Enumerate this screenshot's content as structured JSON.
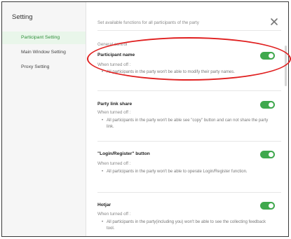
{
  "sidebar": {
    "title": "Setting",
    "items": [
      {
        "label": "Participant Setting",
        "active": true
      },
      {
        "label": "Main Window Setting",
        "active": false
      },
      {
        "label": "Proxy Setting",
        "active": false
      }
    ]
  },
  "main": {
    "subtitle": "Set available functions for all participants of the party",
    "section_label": "General control",
    "settings": [
      {
        "title": "Participant name",
        "when_off": "When turned off :",
        "description": "All participants in the party won't be able to modify their party names.",
        "enabled": true
      },
      {
        "title": "Party link share",
        "when_off": "When turned off :",
        "description": "All participants in the party won't be able see \"copy\" button and can not share the party link.",
        "enabled": true
      },
      {
        "title": "\"Login/Register\" button",
        "when_off": "When turned off :",
        "description": "All participants in the party won't be able to operate Login/Register function.",
        "enabled": true
      },
      {
        "title": "Hotjar",
        "when_off": "When turned off :",
        "description": "All participants in the party(including you) won't be able to see the collecting feedback tool.",
        "enabled": true
      }
    ]
  },
  "icons": {
    "close": "close-icon"
  },
  "colors": {
    "accent": "#3fa84d",
    "annotation": "#e01f1f",
    "active_bg": "#e9f6ea"
  }
}
